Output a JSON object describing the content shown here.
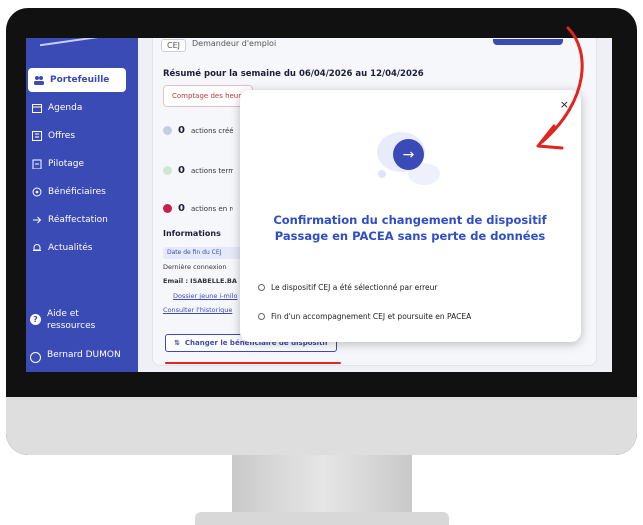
{
  "sidebar": {
    "items": [
      {
        "label": "Portefeuille",
        "icon": "people-icon",
        "active": true
      },
      {
        "label": "Agenda",
        "icon": "calendar-icon"
      },
      {
        "label": "Offres",
        "icon": "offers-icon"
      },
      {
        "label": "Pilotage",
        "icon": "clipboard-icon"
      },
      {
        "label": "Bénéficiaires",
        "icon": "search-icon"
      },
      {
        "label": "Réaffectation",
        "icon": "arrow-right-icon"
      },
      {
        "label": "Actualités",
        "icon": "bell-icon"
      }
    ],
    "help": {
      "line1": "Aide et",
      "line2": "ressources"
    },
    "user": {
      "name": "Bernard DUMON"
    }
  },
  "main": {
    "chip_dispositif": "CEJ",
    "chip_status": "Demandeur d'emploi",
    "summary_title": "Résumé pour la semaine du 06/04/2026 au 12/04/2026",
    "count_button": "Comptage des heures",
    "actions": [
      {
        "count": "0",
        "label": "actions créées",
        "color": "#c6cbe6"
      },
      {
        "count": "0",
        "label": "actions terminées",
        "color": "#cfe6d3"
      },
      {
        "count": "0",
        "label": "actions en retard",
        "color": "#c8204a"
      }
    ],
    "info_title": "Informations",
    "info_chip": "Date de fin du CEJ",
    "last_login": "Dernière connexion",
    "email": "Email : ISABELLE.BA",
    "folder_link": "Dossier jeune i-milo",
    "history_link": "Consulter l'historique",
    "change_button": "Changer le bénéficiaire de dispositif"
  },
  "modal": {
    "title_line1": "Confirmation du changement de dispositif",
    "title_line2": "Passage en PACEA sans perte de données",
    "close": "×",
    "arrow_glyph": "→",
    "options": [
      "Le dispositif CEJ a été sélectionné par erreur",
      "Fin d'un accompagnement CEJ et poursuite en PACEA"
    ]
  },
  "colors": {
    "brand": "#3b4bb5",
    "title": "#2e4dc6",
    "annotation": "#e0241f"
  }
}
